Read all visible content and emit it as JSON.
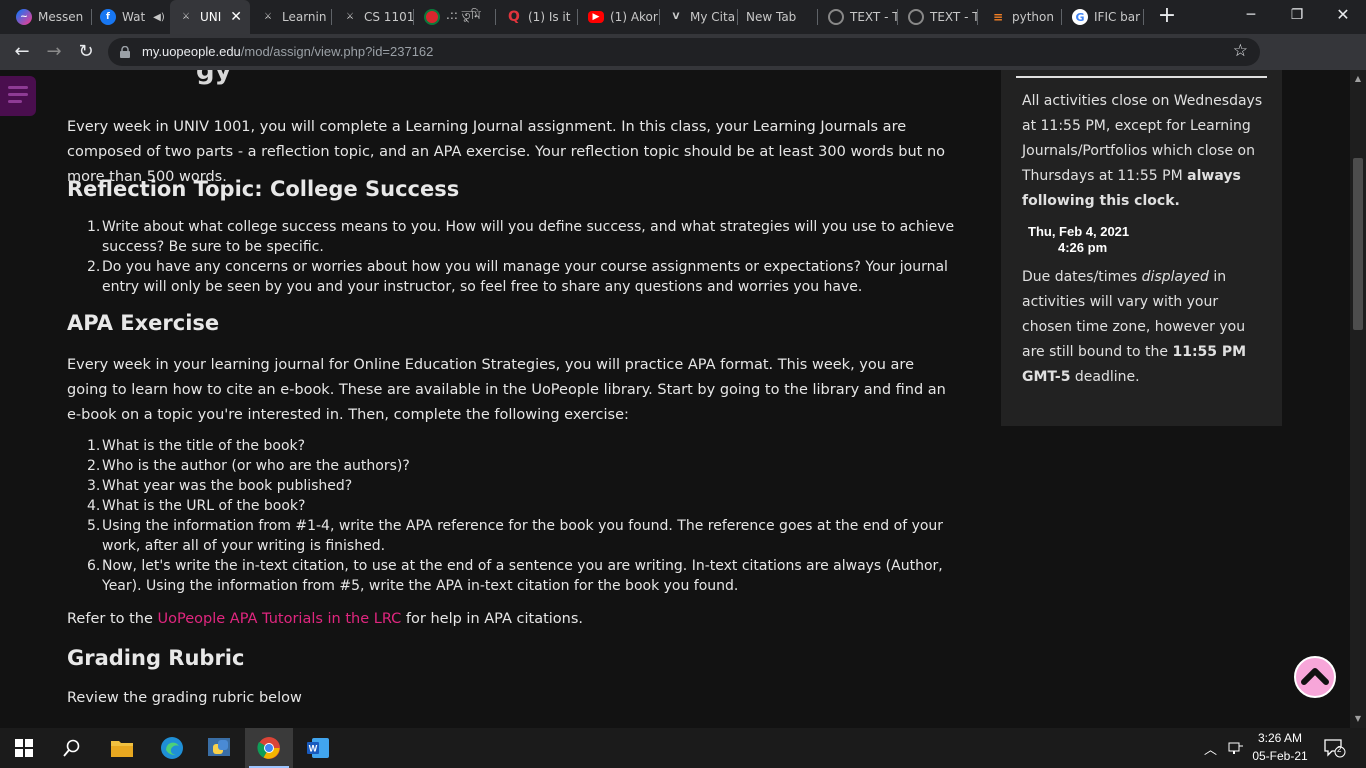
{
  "browser": {
    "tabs": [
      {
        "title": "Messen",
        "icon": "messenger-icon"
      },
      {
        "title": "Wat",
        "icon": "facebook-icon"
      },
      {
        "title": "UNI",
        "icon": "uopeople-icon",
        "active": true
      },
      {
        "title": "Learnin",
        "icon": "uopeople-icon"
      },
      {
        "title": "CS 1101",
        "icon": "uopeople-icon"
      },
      {
        "title": ".:: তুমি",
        "icon": "bangladesh-gov-icon"
      },
      {
        "title": "(1) Is it",
        "icon": "quora-icon"
      },
      {
        "title": "(1) Akor",
        "icon": "youtube-icon"
      },
      {
        "title": "My Cita",
        "icon": "mycitation-icon"
      },
      {
        "title": "New Tab",
        "icon": ""
      },
      {
        "title": "TEXT - T",
        "icon": "globe-icon"
      },
      {
        "title": "TEXT - T",
        "icon": "globe-icon"
      },
      {
        "title": "python",
        "icon": "stackoverflow-icon"
      },
      {
        "title": "IFIC bar",
        "icon": "google-icon"
      }
    ],
    "url_host": "my.uopeople.edu",
    "url_path": "/mod/assign/view.php?id=237162"
  },
  "page": {
    "intro": "Every week in UNIV 1001, you will complete a Learning Journal assignment. In this class, your Learning Journals are composed of two parts - a reflection topic, and an APA exercise. Your reflection topic should be at least 300 words but no more than 500 words.",
    "reflection_heading": "Reflection Topic: College Success",
    "reflection_items": [
      "Write about what college success means to you. How will you define success, and what strategies will you use to achieve success? Be sure to be specific.",
      "Do you have any concerns or worries about how you will manage your course assignments or expectations? Your journal entry will only be seen by you and your instructor, so feel free to share any questions and worries you have."
    ],
    "apa_heading": "APA Exercise",
    "apa_intro": "Every week in your learning journal for Online Education Strategies, you will practice APA format. This week, you are going to learn how to cite an e-book. These are available in the UoPeople library. Start by going to the library and find an e-book on a topic you're interested in. Then, complete the following exercise:",
    "apa_items": [
      "What is the title of the book?",
      "Who is the author (or who are the authors)?",
      "What year was the book published?",
      "What is the URL of the book?",
      "Using the information from #1-4, write the APA reference for the book you found. The reference goes at the end of your work, after all of your writing is finished.",
      "Now, let's write the in-text citation, to use at the end of a sentence you are writing. In-text citations are always (Author, Year). Using the information from #5, write the APA in-text citation for the book you found."
    ],
    "refer_prefix": "Refer to the ",
    "refer_link": "UoPeople APA Tutorials in the LRC",
    "refer_suffix": " for help in APA citations.",
    "grading_heading": "Grading Rubric",
    "grading_text": "Review the grading rubric below"
  },
  "sidebar_block": {
    "text1_a": "All activities close on Wednesdays at 11:55 PM, except for Learning Journals/Portfolios which close on Thursdays at 11:55 PM ",
    "text1_b": "always following this clock.",
    "clock_date": "Thu, Feb 4, 2021",
    "clock_time": "4:26 pm",
    "text2_a": "Due dates/times ",
    "text2_em": "displayed",
    "text2_b": " in activities will vary with your chosen time zone, however you are still bound to the ",
    "text2_bold": "11:55 PM GMT-5",
    "text2_c": " deadline."
  },
  "taskbar": {
    "time": "3:26 AM",
    "date": "05-Feb-21",
    "notifications": "2"
  },
  "colors": {
    "accent_link": "#e0267f",
    "back_to_top": "#f7a6d9",
    "drawer": "#4a0e4e"
  }
}
